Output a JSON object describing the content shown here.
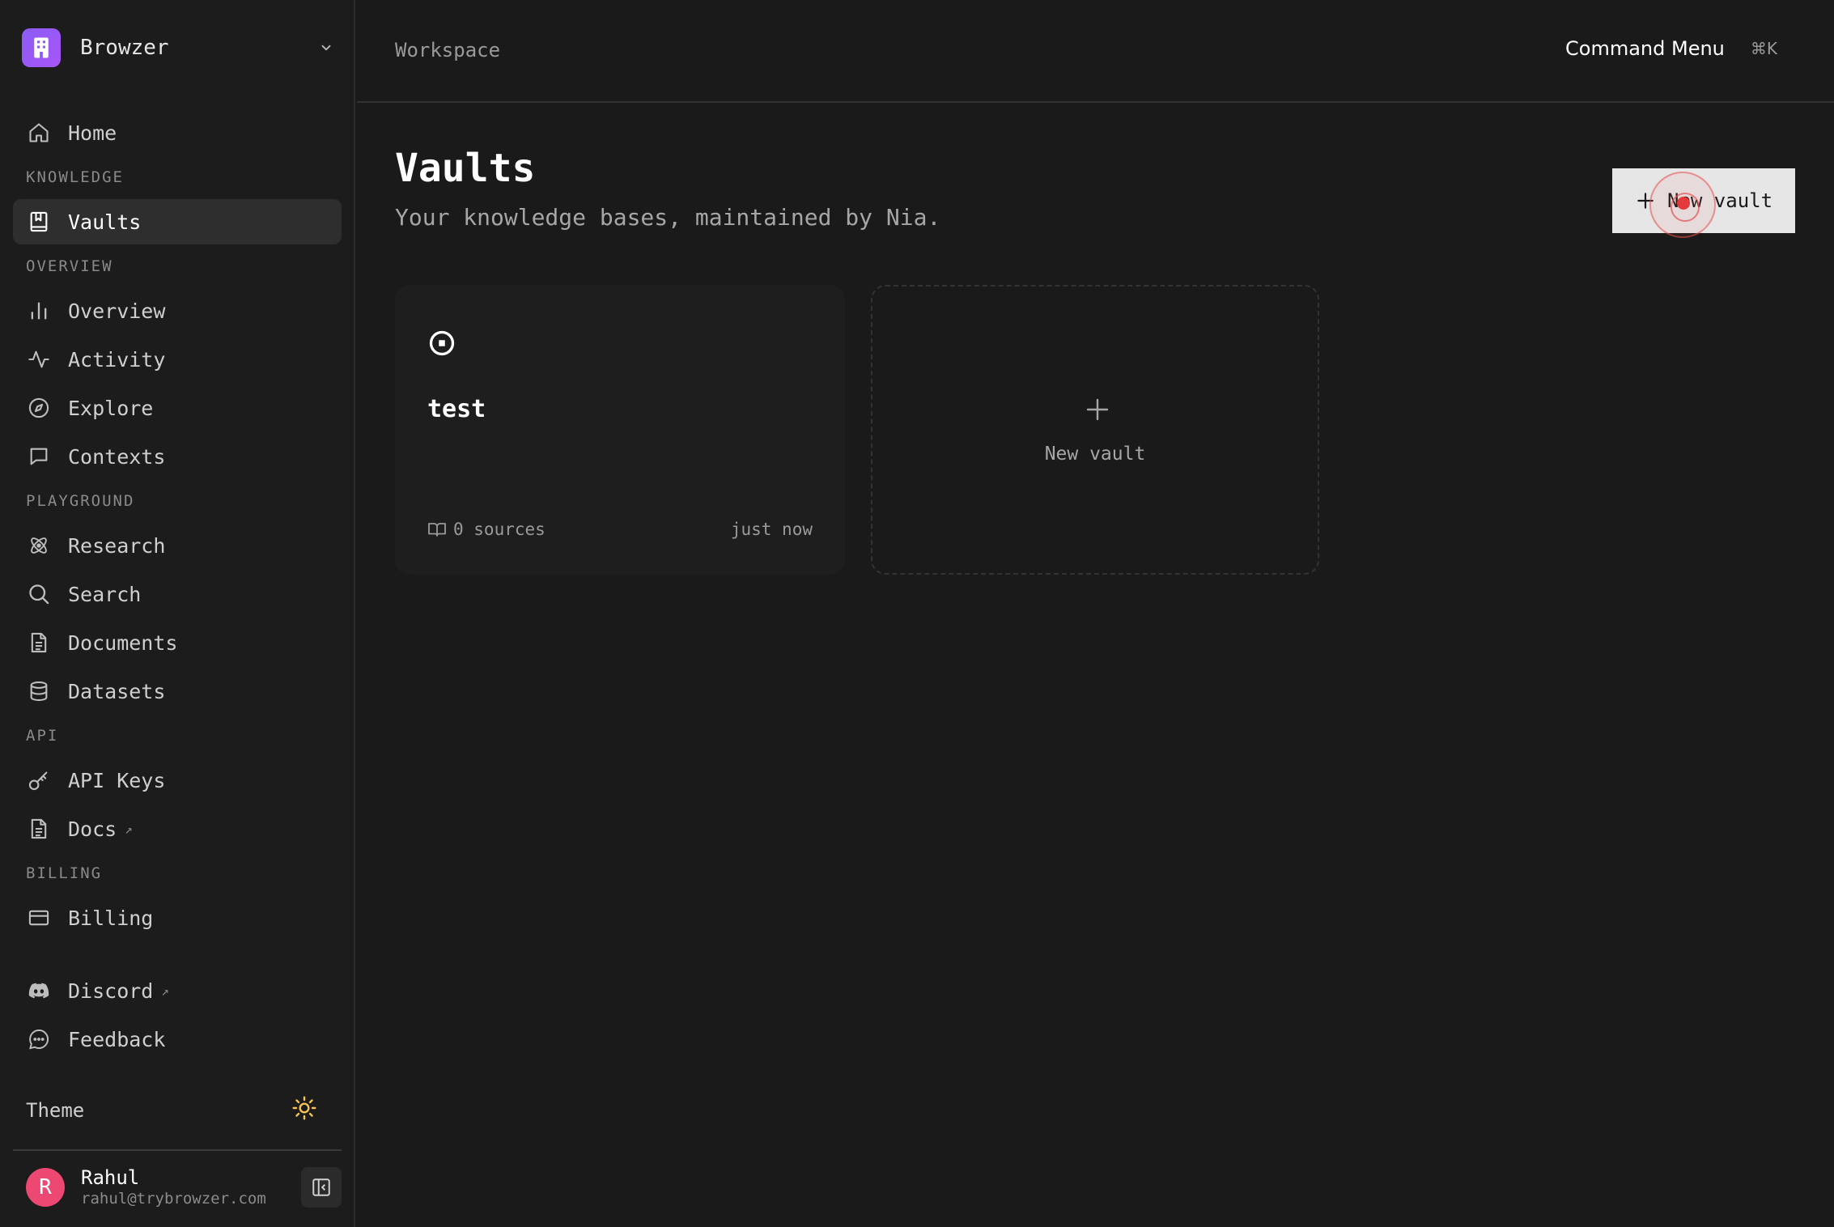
{
  "workspace": {
    "name": "Browzer"
  },
  "sidebar": {
    "home": {
      "label": "Home"
    },
    "sections": {
      "knowledge": "KNOWLEDGE",
      "overview": "OVERVIEW",
      "playground": "PLAYGROUND",
      "api": "API",
      "billing": "BILLING"
    },
    "items": {
      "vaults": "Vaults",
      "overview": "Overview",
      "activity": "Activity",
      "explore": "Explore",
      "contexts": "Contexts",
      "research": "Research",
      "search": "Search",
      "documents": "Documents",
      "datasets": "Datasets",
      "api_keys": "API Keys",
      "docs": "Docs",
      "billing": "Billing",
      "discord": "Discord",
      "feedback": "Feedback"
    },
    "external_arrow": "↗",
    "theme_label": "Theme"
  },
  "user": {
    "initial": "R",
    "name": "Rahul",
    "email": "rahul@trybrowzer.com"
  },
  "topbar": {
    "breadcrumb": "Workspace",
    "command_menu": "Command Menu",
    "shortcut": "⌘K"
  },
  "page": {
    "title": "Vaults",
    "subtitle": "Your knowledge bases, maintained by Nia.",
    "new_button": "New vault"
  },
  "vaults": [
    {
      "name": "test",
      "sources": "0 sources",
      "updated": "just now"
    }
  ],
  "new_vault_card": {
    "label": "New vault"
  },
  "colors": {
    "accent": "#8b5cf6",
    "avatar": "#ec4872",
    "theme_icon": "#f5c451"
  }
}
